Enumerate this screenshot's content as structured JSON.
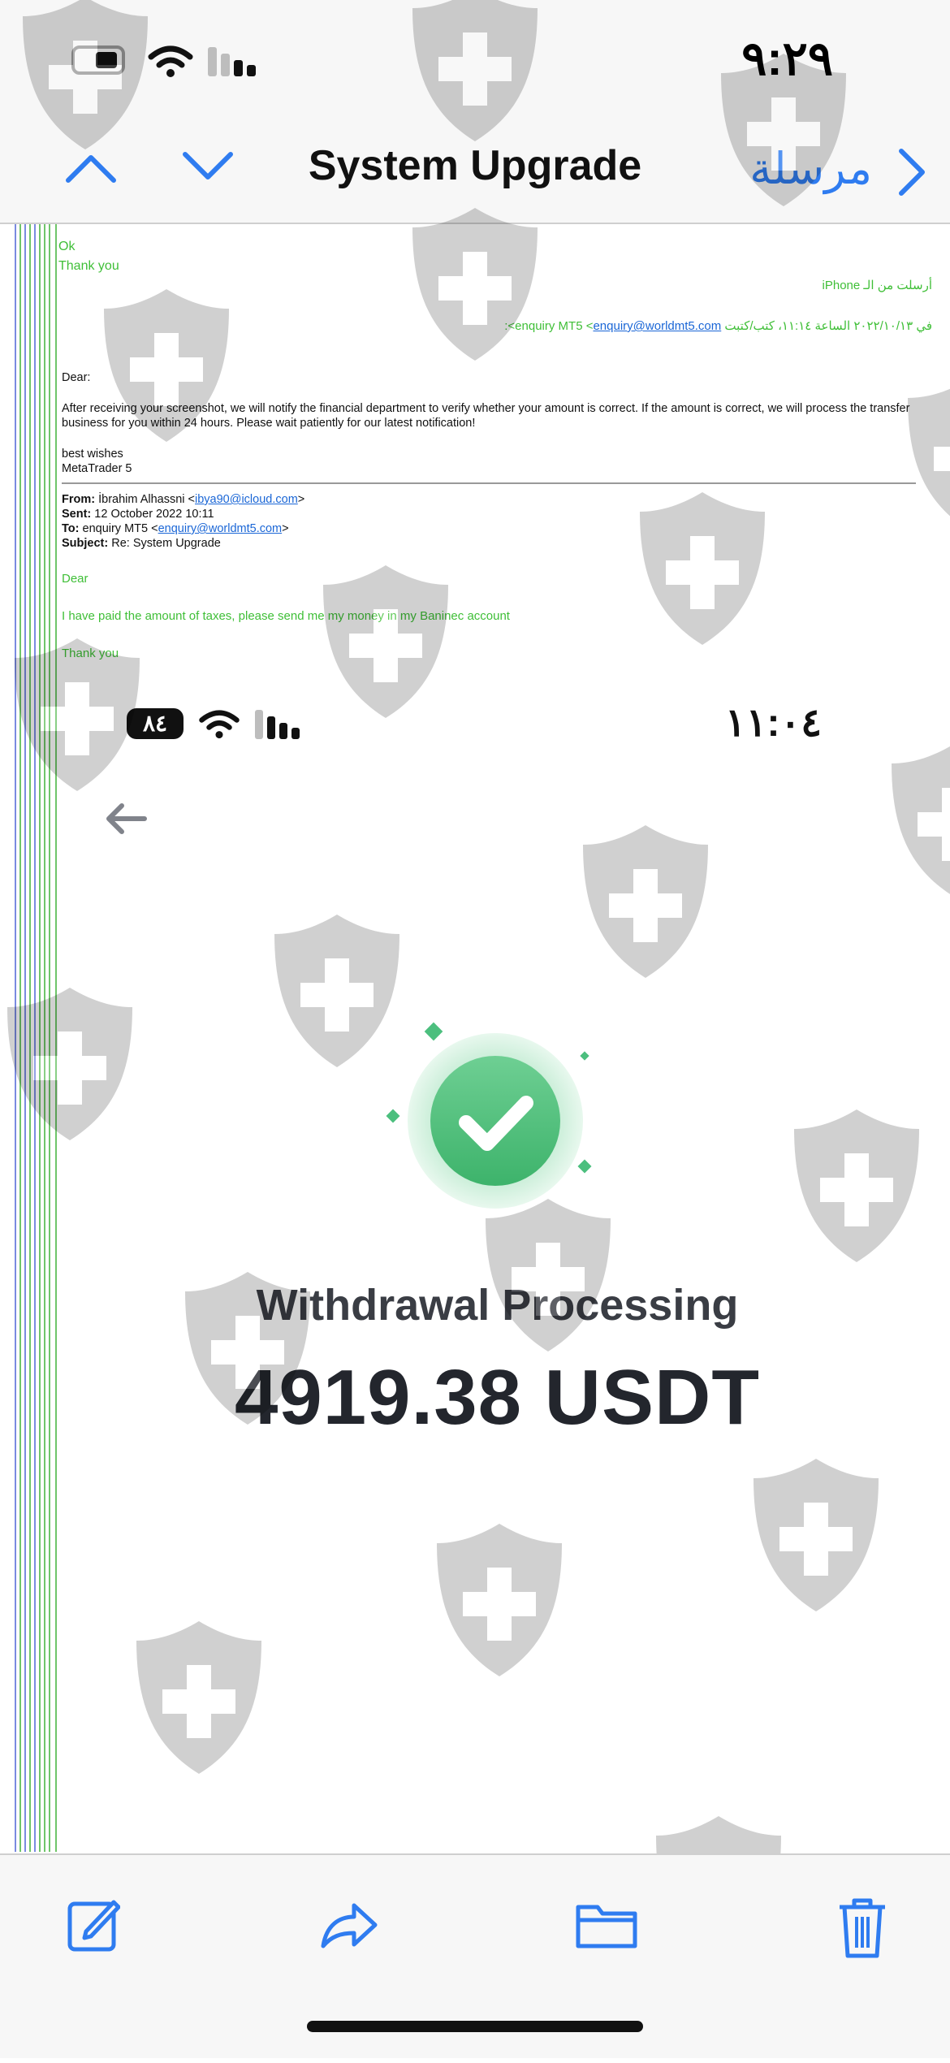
{
  "status_bar": {
    "time": "٩:٢٩"
  },
  "nav": {
    "title": "System Upgrade",
    "back_label": "مرسلة"
  },
  "email": {
    "reply_lines": [
      "Ok",
      "Thank you"
    ],
    "signature": "أرسلت من الـ iPhone",
    "on_wrote_prefix": "في ٢٠٢٢/١٠/١٣ الساعة ١١:١٤، كتب/كتبت enquiry MT5 <",
    "on_wrote_email": "enquiry@worldmt5.com",
    "on_wrote_suffix": ">:",
    "greeting": "Dear:",
    "body": "After receiving your screenshot, we will notify the financial department to verify whether your amount is correct. If the amount is correct, we will process the transfer business for you within 24 hours. Please wait patiently for our latest notification!",
    "closing": "best wishes",
    "sender_name": "MetaTrader 5",
    "from_label": "From:",
    "from_name": "İbrahim Alhassni <",
    "from_email": "ibya90@icloud.com",
    "sent_label": "Sent:",
    "sent_value": "12 October 2022 10:11",
    "to_label": "To:",
    "to_name": "enquiry MT5 <",
    "to_email": "enquiry@worldmt5.com",
    "subject_label": "Subject:",
    "subject_value": "Re: System Upgrade",
    "quoted_dear": "Dear",
    "quoted_body": "I have paid the amount of taxes, please send me my money in my Baninec account",
    "quoted_thanks": "Thank you"
  },
  "screenshot": {
    "battery": "٨٤",
    "time": "١١:٠٤",
    "title": "Withdrawal Processing",
    "amount": "4919.38 USDT"
  },
  "colors": {
    "accent": "#2f7cf0",
    "green_text": "#3fbf37",
    "success": "#4cbf7e"
  },
  "toolbar": [
    "compose-icon",
    "forward-icon",
    "folder-icon",
    "trash-icon"
  ]
}
